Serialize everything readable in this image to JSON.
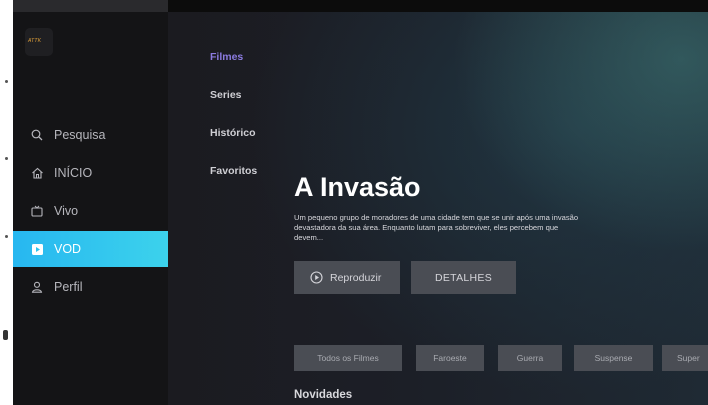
{
  "sidebar": {
    "logo_text": "ATTK",
    "items": [
      {
        "label": "Pesquisa",
        "icon": "search-icon",
        "active": false
      },
      {
        "label": "INÍCIO",
        "icon": "home-icon",
        "active": false
      },
      {
        "label": "Vivo",
        "icon": "tv-icon",
        "active": false
      },
      {
        "label": "VOD",
        "icon": "play-square-icon",
        "active": true
      },
      {
        "label": "Perfil",
        "icon": "user-icon",
        "active": false
      }
    ],
    "active_color": "#2ec4ee"
  },
  "categories": [
    {
      "label": "Filmes",
      "active": true
    },
    {
      "label": "Series",
      "active": false
    },
    {
      "label": "Histórico",
      "active": false
    },
    {
      "label": "Favoritos",
      "active": false
    }
  ],
  "featured": {
    "title": "A Invasão",
    "description": "Um pequeno grupo de moradores de uma cidade tem que se unir após uma invasão devastadora da sua área. Enquanto lutam para sobreviver, eles percebem que devem...",
    "play_label": "Reproduzir",
    "details_label": "DETALHES"
  },
  "genres": [
    "Todos os Filmes",
    "Faroeste",
    "Guerra",
    "Suspense",
    "Super"
  ],
  "section_title": "Novidades",
  "accent_color": "#8b7be0"
}
